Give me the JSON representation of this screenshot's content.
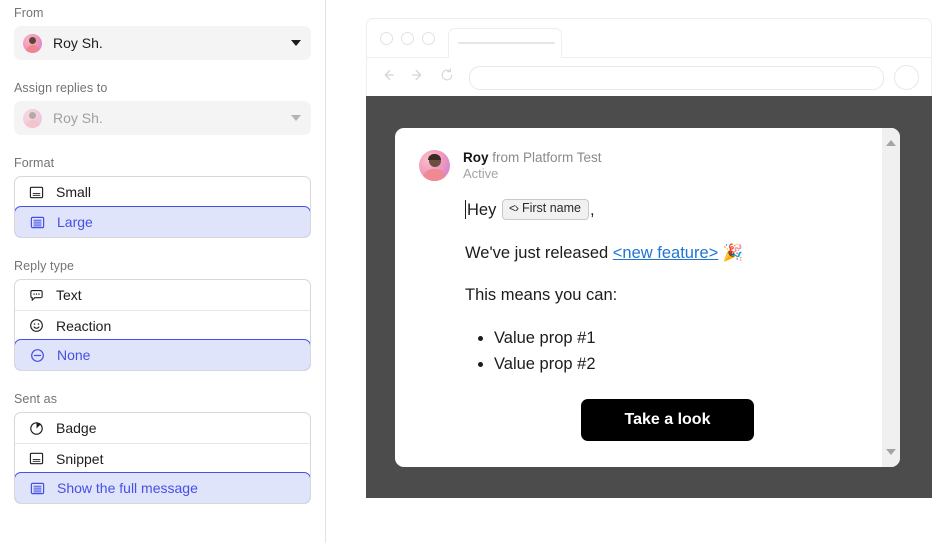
{
  "sidebar": {
    "from": {
      "label": "From",
      "value": "Roy Sh.",
      "avatar_icon": "user-avatar",
      "caret_icon": "chevron-down-icon"
    },
    "assign_replies": {
      "label": "Assign replies to",
      "value": "Roy Sh.",
      "avatar_icon": "user-avatar",
      "caret_icon": "chevron-down-icon",
      "disabled": true
    },
    "format": {
      "label": "Format",
      "options": [
        {
          "label": "Small",
          "icon": "layout-small-icon",
          "selected": false
        },
        {
          "label": "Large",
          "icon": "layout-large-icon",
          "selected": true
        }
      ]
    },
    "reply_type": {
      "label": "Reply type",
      "options": [
        {
          "label": "Text",
          "icon": "speech-bubble-icon",
          "selected": false
        },
        {
          "label": "Reaction",
          "icon": "smiley-face-icon",
          "selected": false
        },
        {
          "label": "None",
          "icon": "circle-minus-icon",
          "selected": true
        }
      ]
    },
    "sent_as": {
      "label": "Sent as",
      "options": [
        {
          "label": "Badge",
          "icon": "badge-pie-icon",
          "selected": false
        },
        {
          "label": "Snippet",
          "icon": "snippet-icon",
          "selected": false
        },
        {
          "label": "Show the full message",
          "icon": "full-message-icon",
          "selected": true
        }
      ]
    }
  },
  "preview": {
    "browser": {
      "dots_icon": "window-controls-icon",
      "back_icon": "arrow-left-icon",
      "forward_icon": "arrow-right-icon",
      "reload_icon": "reload-icon",
      "url_value": "",
      "profile_icon": "profile-circle-icon"
    },
    "message": {
      "avatar_icon": "sender-avatar",
      "sender_name": "Roy",
      "sender_org": " from Platform Test",
      "status": "Active",
      "greeting_prefix": "Hey",
      "token_chip": "First name",
      "token_icon": "code-brackets-icon",
      "greeting_suffix": ",",
      "line2_prefix": "We've just released ",
      "line2_link": "<new feature>",
      "line2_emoji": "🎉",
      "line3": "This means you can:",
      "bullets": [
        "Value prop #1",
        "Value prop #2"
      ],
      "cta_label": "Take a look",
      "scroll_up_icon": "scroll-up-arrow",
      "scroll_down_icon": "scroll-down-arrow"
    }
  },
  "colors": {
    "accent": "#4550e6",
    "accent_bg": "#e0e4fa",
    "overlay": "#4c4c4c",
    "link": "#1f74d4",
    "cta_bg": "#000000"
  }
}
